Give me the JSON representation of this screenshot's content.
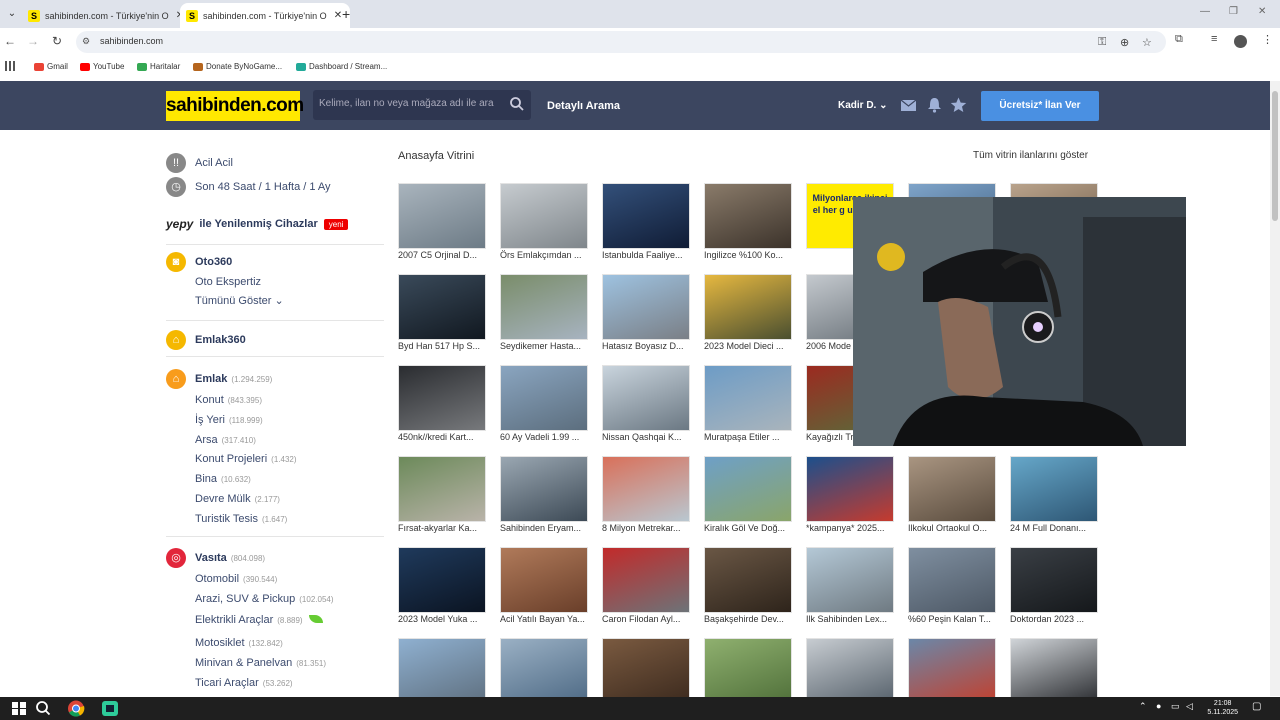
{
  "browser": {
    "tabs": [
      {
        "title": "sahibinden.com - Türkiye'nin O",
        "favicon": "S"
      },
      {
        "title": "sahibinden.com - Türkiye'nin O",
        "favicon": "S"
      }
    ],
    "url": "sahibinden.com",
    "bookmarks": [
      "Gmail",
      "YouTube",
      "Haritalar",
      "Donate ByNoGame...",
      "Dashboard / Stream..."
    ]
  },
  "header": {
    "logo": "sahibinden.com",
    "search_placeholder": "Kelime, ilan no veya mağaza adı ile ara",
    "detailed_search": "Detaylı Arama",
    "user": "Kadir D.",
    "post_button": "Ücretsiz* İlan Ver",
    "colors": {
      "header_bg": "#3c4660",
      "logo_bg": "#ffe800",
      "button": "#4a90e2"
    }
  },
  "sidebar": {
    "urgent": "Acil Acil",
    "recent": "Son 48 Saat / 1 Hafta / 1 Ay",
    "yepy": "yepy",
    "yepy_text": "ile Yenilenmiş Cihazlar",
    "yepy_badge": "yeni",
    "oto360": "Oto360",
    "oto_expertiz": "Oto Ekspertiz",
    "show_all": "Tümünü Göster",
    "emlak360": "Emlak360",
    "emlak": {
      "label": "Emlak",
      "count": "(1.294.259)"
    },
    "emlak_items": [
      {
        "label": "Konut",
        "count": "(843.395)"
      },
      {
        "label": "İş Yeri",
        "count": "(118.999)"
      },
      {
        "label": "Arsa",
        "count": "(317.410)"
      },
      {
        "label": "Konut Projeleri",
        "count": "(1.432)"
      },
      {
        "label": "Bina",
        "count": "(10.632)"
      },
      {
        "label": "Devre Mülk",
        "count": "(2.177)"
      },
      {
        "label": "Turistik Tesis",
        "count": "(1.647)"
      }
    ],
    "vasita": {
      "label": "Vasıta",
      "count": "(804.098)"
    },
    "vasita_items": [
      {
        "label": "Otomobil",
        "count": "(390.544)"
      },
      {
        "label": "Arazi, SUV & Pickup",
        "count": "(102.054)"
      },
      {
        "label": "Elektrikli Araçlar",
        "count": "(8.889)"
      },
      {
        "label": "Motosiklet",
        "count": "(132.842)"
      },
      {
        "label": "Minivan & Panelvan",
        "count": "(81.351)"
      },
      {
        "label": "Ticari Araçlar",
        "count": "(53.262)"
      }
    ]
  },
  "main": {
    "title": "Anasayfa Vitrini",
    "see_all": "Tüm vitrin ilanlarını göster",
    "banner_text": "Milyonlarca ikinci el her g uygun fiy",
    "listings": [
      "2007 C5 Orjinal D...",
      "Örs Emlakçımdan ...",
      "Istanbulda Faaliye...",
      "Ingilizce %100 Ko...",
      "",
      "",
      "",
      "Byd Han 517 Hp S...",
      "Seydikemer Hasta...",
      "Hatasız Boyasız D...",
      "2023 Model Dieci ...",
      "2006 Mode",
      "",
      "",
      "450nk//kredi Kart...",
      "60 Ay Vadeli 1.99 ...",
      "Nissan Qashqai K...",
      "Muratpaşa Etiler ...",
      "Kayağızlı Tr",
      "",
      "",
      "Fırsat-akyarlar Ka...",
      "Sahibinden Eryam...",
      "8 Milyon Metrekar...",
      "Kiralık Göl Ve Doğ...",
      "*kampanya* 2025...",
      "Ilkokul Ortaokul O...",
      "24 M Full Donanı...",
      "2023 Model Yuka ...",
      "Acil Yatılı Bayan Ya...",
      "Caron Filodan Ayl...",
      "Başakşehirde Dev...",
      "Ilk Sahibinden Lex...",
      "%60 Peşin Kalan T...",
      "Doktordan 2023 ...",
      "",
      "",
      "",
      "",
      "",
      "",
      ""
    ]
  },
  "taskbar": {
    "time": "21:08",
    "date": "5.11.2025"
  }
}
